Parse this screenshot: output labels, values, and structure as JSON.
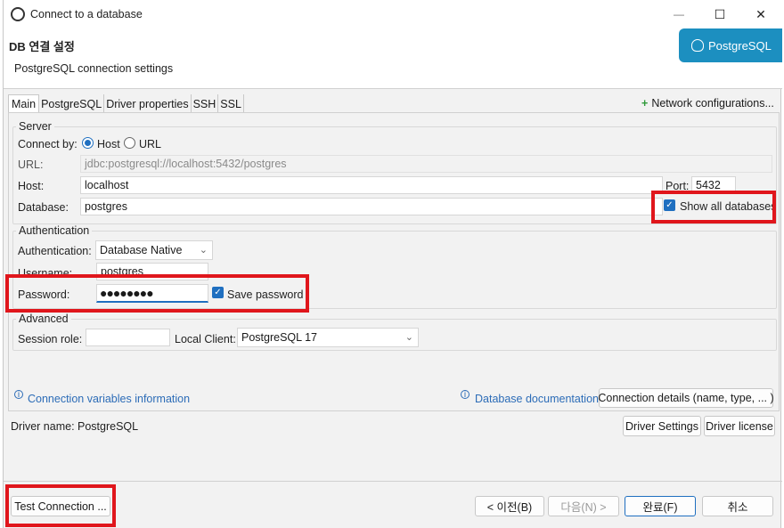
{
  "window": {
    "title": "Connect to a database",
    "controls": {
      "minimize": "—",
      "maximize": "☐",
      "close": "✕"
    }
  },
  "header": {
    "title": "DB 연결 설정",
    "subtitle": "PostgreSQL connection settings",
    "logo_text": "PostgreSQL"
  },
  "tabs": [
    {
      "label": "Main",
      "active": true
    },
    {
      "label": "PostgreSQL"
    },
    {
      "label": "Driver properties"
    },
    {
      "label": "SSH"
    },
    {
      "label": "SSL"
    }
  ],
  "network_config": {
    "icon": "+",
    "label": "Network configurations..."
  },
  "server": {
    "group_title": "Server",
    "connect_by_label": "Connect by:",
    "option_host": "Host",
    "option_url": "URL",
    "selected": "Host",
    "url_label": "URL:",
    "url_value": "jdbc:postgresql://localhost:5432/postgres",
    "host_label": "Host:",
    "host_value": "localhost",
    "port_label": "Port:",
    "port_value": "5432",
    "database_label": "Database:",
    "database_value": "postgres",
    "show_all_databases_label": "Show all databases",
    "show_all_databases_checked": true
  },
  "authentication": {
    "group_title": "Authentication",
    "auth_label": "Authentication:",
    "auth_value": "Database Native",
    "username_label": "Username:",
    "username_value": "postgres",
    "password_label": "Password:",
    "password_mask": "●●●●●●●●",
    "save_password_label": "Save password",
    "save_password_checked": true
  },
  "advanced": {
    "group_title": "Advanced",
    "session_role_label": "Session role:",
    "session_role_value": "",
    "local_client_label": "Local Client:",
    "local_client_value": "PostgreSQL 17"
  },
  "links": {
    "connection_variables": "Connection variables information",
    "database_documentation": "Database documentation",
    "connection_details_button": "Connection details (name, type, ... )"
  },
  "driver": {
    "name_label": "Driver name:",
    "name_value": "PostgreSQL",
    "settings_button": "Driver Settings",
    "license_button": "Driver license"
  },
  "footer": {
    "test_connection": "Test Connection ...",
    "back": "< 이전(B)",
    "next": "다음(N) >",
    "finish": "완료(F)",
    "cancel": "취소"
  },
  "colors": {
    "accent": "#1f6fc0",
    "link": "#2c6cb7",
    "highlight_box": "#e0161c",
    "logo_bg": "#1c8fc0"
  }
}
